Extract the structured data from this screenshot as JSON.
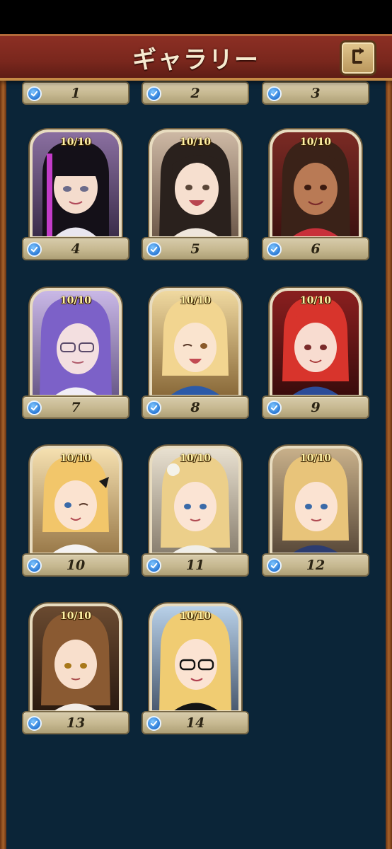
{
  "header": {
    "title": "ギャラリー"
  },
  "gallery": {
    "items": [
      {
        "id": "1",
        "progress": "",
        "unlocked": true
      },
      {
        "id": "2",
        "progress": "",
        "unlocked": true
      },
      {
        "id": "3",
        "progress": "",
        "unlocked": true
      },
      {
        "id": "4",
        "progress": "10/10",
        "unlocked": true
      },
      {
        "id": "5",
        "progress": "10/10",
        "unlocked": true
      },
      {
        "id": "6",
        "progress": "10/10",
        "unlocked": true
      },
      {
        "id": "7",
        "progress": "10/10",
        "unlocked": true
      },
      {
        "id": "8",
        "progress": "10/10",
        "unlocked": true
      },
      {
        "id": "9",
        "progress": "10/10",
        "unlocked": true
      },
      {
        "id": "10",
        "progress": "10/10",
        "unlocked": true
      },
      {
        "id": "11",
        "progress": "10/10",
        "unlocked": true
      },
      {
        "id": "12",
        "progress": "10/10",
        "unlocked": true
      },
      {
        "id": "13",
        "progress": "10/10",
        "unlocked": true
      },
      {
        "id": "14",
        "progress": "10/10",
        "unlocked": true
      }
    ]
  },
  "colors": {
    "background": "#0b2538",
    "header": "#7a271d",
    "plate": "#c6b890",
    "check": "#2b7ad6",
    "progress_text": "#fff2a6"
  }
}
